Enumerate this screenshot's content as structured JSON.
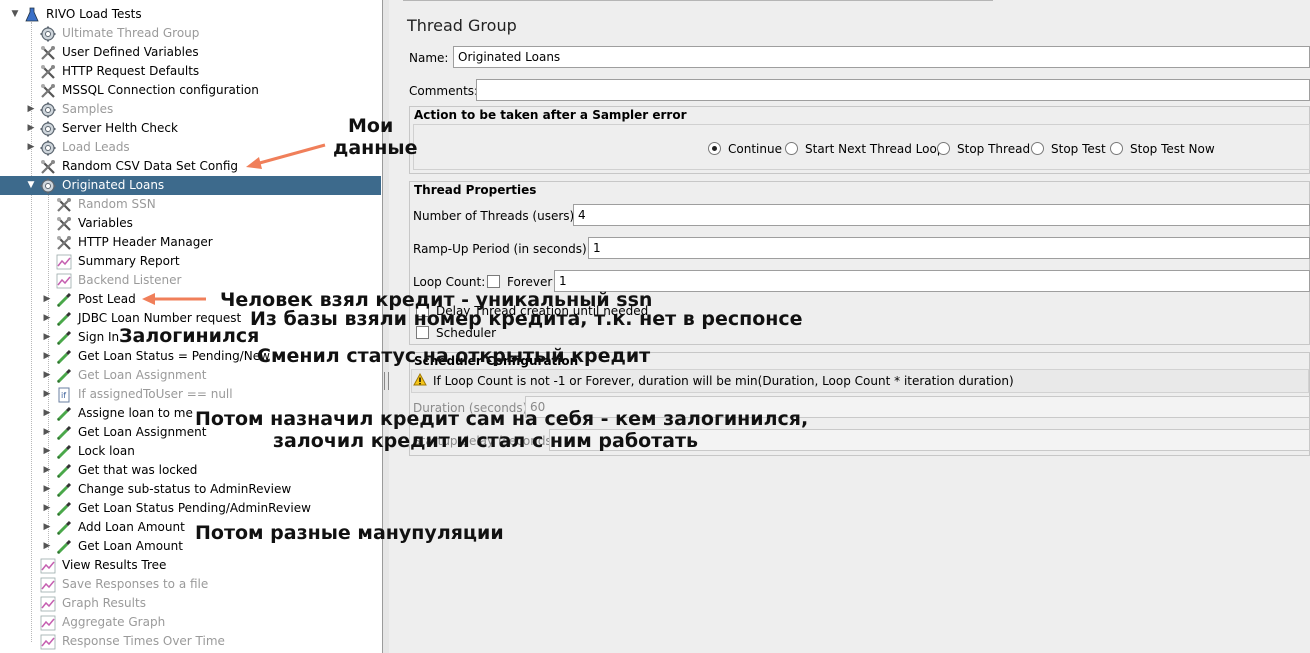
{
  "tree": {
    "items": [
      {
        "label": "RIVO Load Tests",
        "icon": "flask-icon",
        "expander": "open",
        "disabled": false
      },
      {
        "label": "Ultimate Thread Group",
        "icon": "gear-icon",
        "expander": "",
        "disabled": true
      },
      {
        "label": "User Defined Variables",
        "icon": "wrench-icon",
        "expander": "",
        "disabled": false
      },
      {
        "label": "HTTP Request Defaults",
        "icon": "wrench-icon",
        "expander": "",
        "disabled": false
      },
      {
        "label": "MSSQL Connection configuration",
        "icon": "wrench-icon",
        "expander": "",
        "disabled": false
      },
      {
        "label": "Samples",
        "icon": "gear-icon",
        "expander": "closed",
        "disabled": true
      },
      {
        "label": "Server Helth Check",
        "icon": "gear-icon",
        "expander": "closed",
        "disabled": false
      },
      {
        "label": "Load Leads",
        "icon": "gear-icon",
        "expander": "closed",
        "disabled": true
      },
      {
        "label": "Random CSV Data Set Config",
        "icon": "wrench-icon",
        "expander": "",
        "disabled": false
      },
      {
        "label": "Originated Loans",
        "icon": "gear-icon",
        "expander": "open",
        "disabled": false,
        "selected": true
      },
      {
        "label": "Random SSN",
        "icon": "wrench-icon",
        "expander": "",
        "disabled": true
      },
      {
        "label": "Variables",
        "icon": "wrench-icon",
        "expander": "",
        "disabled": false
      },
      {
        "label": "HTTP Header Manager",
        "icon": "wrench-icon",
        "expander": "",
        "disabled": false
      },
      {
        "label": "Summary Report",
        "icon": "graph-icon",
        "expander": "",
        "disabled": false
      },
      {
        "label": "Backend Listener",
        "icon": "graph-icon",
        "expander": "",
        "disabled": true
      },
      {
        "label": "Post Lead",
        "icon": "pipette-icon",
        "expander": "closed",
        "disabled": false
      },
      {
        "label": "JDBC Loan Number request",
        "icon": "pipette-icon",
        "expander": "closed",
        "disabled": false
      },
      {
        "label": "Sign In",
        "icon": "pipette-icon",
        "expander": "closed",
        "disabled": false
      },
      {
        "label": "Get Loan Status = Pending/New",
        "icon": "pipette-icon",
        "expander": "closed",
        "disabled": false
      },
      {
        "label": "Get Loan Assignment",
        "icon": "pipette-icon",
        "expander": "closed",
        "disabled": true
      },
      {
        "label": "If assignedToUser == null",
        "icon": "if-icon",
        "expander": "closed",
        "disabled": true
      },
      {
        "label": "Assigne loan to me",
        "icon": "pipette-icon",
        "expander": "closed",
        "disabled": false
      },
      {
        "label": "Get Loan Assignment",
        "icon": "pipette-icon",
        "expander": "closed",
        "disabled": false
      },
      {
        "label": "Lock loan",
        "icon": "pipette-icon",
        "expander": "closed",
        "disabled": false
      },
      {
        "label": "Get that was locked",
        "icon": "pipette-icon",
        "expander": "closed",
        "disabled": false
      },
      {
        "label": "Change sub-status to AdminReview",
        "icon": "pipette-icon",
        "expander": "closed",
        "disabled": false
      },
      {
        "label": "Get Loan Status Pending/AdminReview",
        "icon": "pipette-icon",
        "expander": "closed",
        "disabled": false
      },
      {
        "label": "Add Loan Amount",
        "icon": "pipette-icon",
        "expander": "closed",
        "disabled": false
      },
      {
        "label": "Get Loan Amount",
        "icon": "pipette-icon",
        "expander": "closed",
        "disabled": false
      },
      {
        "label": "View Results Tree",
        "icon": "graph-icon",
        "expander": "",
        "disabled": false
      },
      {
        "label": "Save Responses to a file",
        "icon": "graph-icon",
        "expander": "",
        "disabled": true
      },
      {
        "label": "Graph Results",
        "icon": "graph-icon",
        "expander": "",
        "disabled": true
      },
      {
        "label": "Aggregate Graph",
        "icon": "graph-icon",
        "expander": "",
        "disabled": true
      },
      {
        "label": "Response Times Over Time",
        "icon": "graph-icon",
        "expander": "",
        "disabled": true
      }
    ]
  },
  "panel": {
    "title": "Thread Group",
    "name_label": "Name:",
    "name_value": "Originated Loans",
    "comments_label": "Comments:",
    "comments_value": "",
    "sampler_error": {
      "title": "Action to be taken after a Sampler error",
      "options": [
        "Continue",
        "Start Next Thread Loop",
        "Stop Thread",
        "Stop Test",
        "Stop Test Now"
      ],
      "selected": "Continue"
    },
    "thread_props": {
      "title": "Thread Properties",
      "threads_label": "Number of Threads (users):",
      "threads_value": "4",
      "rampup_label": "Ramp-Up Period (in seconds):",
      "rampup_value": "1",
      "loop_label": "Loop Count:",
      "forever_label": "Forever",
      "loop_value": "1",
      "delay_label": "Delay Thread creation until needed",
      "scheduler_label": "Scheduler"
    },
    "scheduler": {
      "title": "Scheduler Configuration",
      "warning": "If Loop Count is not -1 or Forever, duration will be min(Duration, Loop Count * iteration duration)",
      "duration_label": "Duration (seconds)",
      "duration_value": "60",
      "startup_label": "Startup delay (seconds)"
    }
  },
  "annotations": {
    "moi_line1": "Мои",
    "moi_line2": "данные",
    "post_lead": "Человек взял кредит - уникальный ssn",
    "jdbc": "Из базы взяли номер кредита, т.к. нет в респонсе",
    "sign_in": "Залогинился",
    "status": "Сменил статус на открытый кредит",
    "assign_line1": "Потом назначил кредит сам на себя - кем залогинился,",
    "assign_line2": "залочил кредит и стал с ним работать",
    "misc": "Потом разные манупуляции",
    "arrow_color": "#f07f5a"
  },
  "colors": {
    "selected_row": "#3d6a8c",
    "panel_bg": "#eeeeee",
    "disabled_text": "#9a9a9a"
  }
}
